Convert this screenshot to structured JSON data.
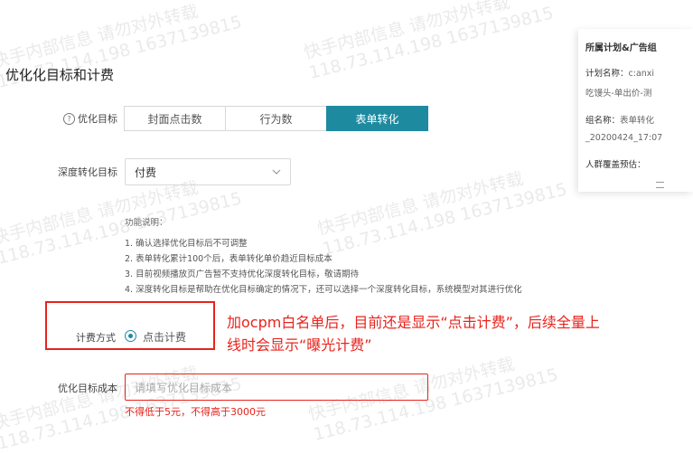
{
  "section_title": "优化化目标和计费",
  "goal": {
    "label": "优化目标",
    "help_icon": "question-circle-icon",
    "options": [
      "封面点击数",
      "行为数",
      "表单转化"
    ],
    "selected_index": 2
  },
  "deep_goal": {
    "label": "深度转化目标",
    "value": "付费"
  },
  "help": {
    "title": "功能说明：",
    "lines": [
      "1. 确认选择优化目标后不可调整",
      "2. 表单转化累计100个后，表单转化单价趋近目标成本",
      "3. 目前视频播放页广告暂不支持优化深度转化目标，敬请期待",
      "4. 深度转化目标是帮助在优化目标确定的情况下，还可以选择一个深度转化目标，系统模型对其进行优化"
    ]
  },
  "billing": {
    "label": "计费方式",
    "option": "点击计费"
  },
  "annotation": {
    "line1": "加ocpm白名单后，目前还是显示“点击计费”，后续全量上",
    "line2": "线时会显示“曝光计费”"
  },
  "cost": {
    "label": "优化目标成本",
    "placeholder": "请填写优化目标成本",
    "error": "不得低于5元，不得高于3000元"
  },
  "side_panel": {
    "title": "所属计划&广告组",
    "plan_label": "计划名称：",
    "plan_value": "c:anxi",
    "plan_value2": "吃馒头-单出价-测",
    "group_label": "组名称：",
    "group_value": "表单转化",
    "group_value2": "_20200424_17:07",
    "audience_label": "人群覆盖预估："
  },
  "watermark": {
    "text1": "快手内部信息 请勿对外转载",
    "text2": "118.73.114.198 1637139815"
  },
  "colors": {
    "accent": "#1e8aa0",
    "error": "#e8231c"
  }
}
